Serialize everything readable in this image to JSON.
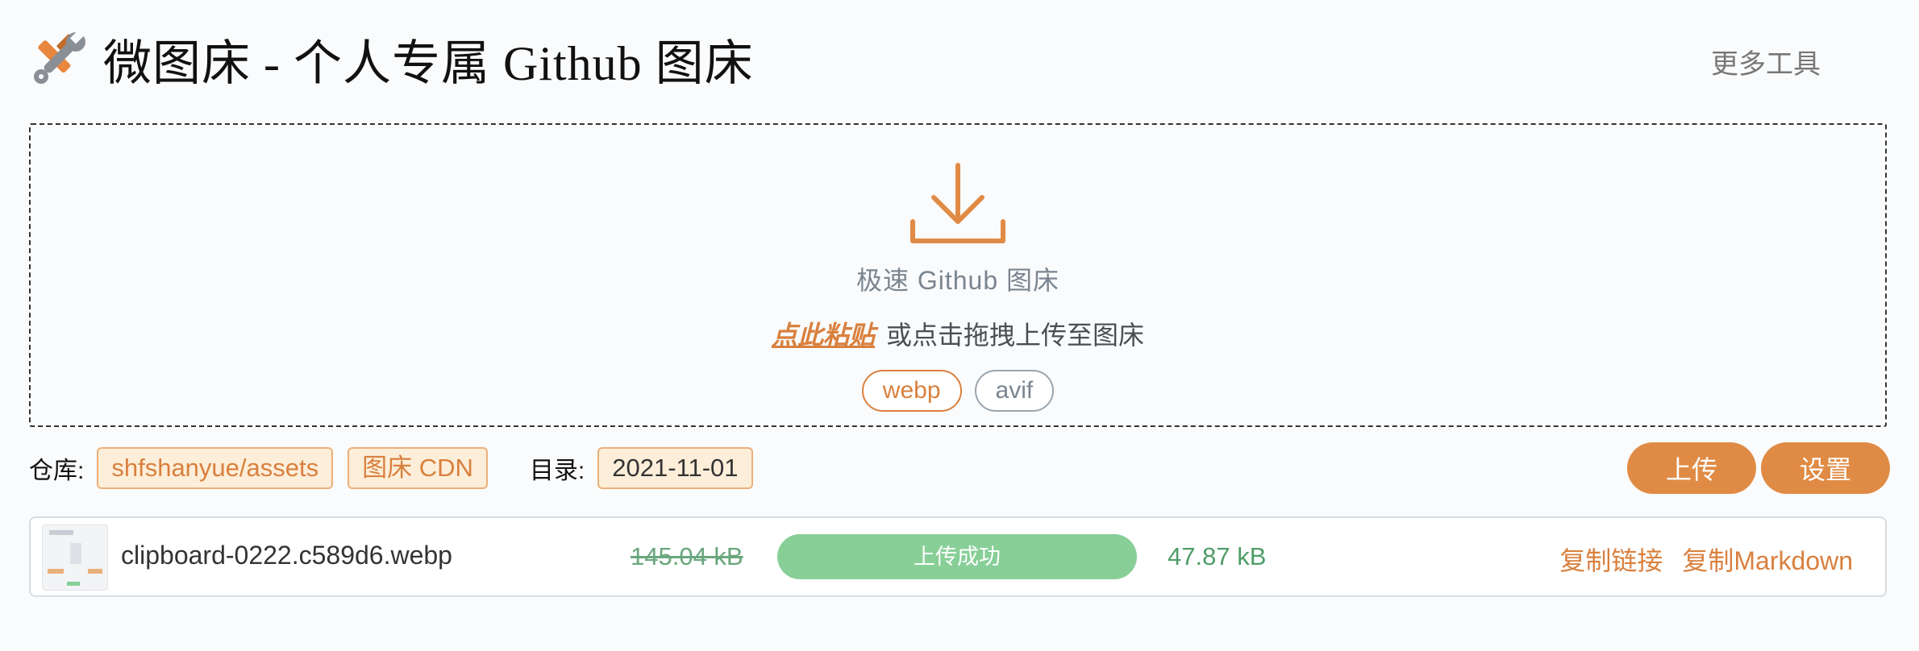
{
  "header": {
    "title": "微图床 - 个人专属 Github 图床",
    "more_tools": "更多工具"
  },
  "dropzone": {
    "title": "极速 Github 图床",
    "paste_link": "点此粘贴",
    "hint": "或点击拖拽上传至图床",
    "formats": [
      {
        "label": "webp",
        "active": true
      },
      {
        "label": "avif",
        "active": false
      }
    ]
  },
  "config": {
    "repo_label": "仓库:",
    "repo_value": "shfshanyue/assets",
    "cdn_label": "图床 CDN",
    "dir_label": "目录:",
    "dir_value": "2021-11-01",
    "upload_button": "上传",
    "settings_button": "设置"
  },
  "files": [
    {
      "name": "clipboard-0222.c589d6.webp",
      "original_size": "145.04 kB",
      "status": "上传成功",
      "progress": 1.0,
      "new_size": "47.87 kB",
      "copy_link": "复制链接",
      "copy_markdown": "复制Markdown"
    }
  ],
  "colors": {
    "accent": "#e08b45",
    "success": "#88cf97",
    "tag_bg": "#fdeed9"
  },
  "icons": {
    "logo": "tools-icon",
    "upload_area": "download-icon"
  }
}
